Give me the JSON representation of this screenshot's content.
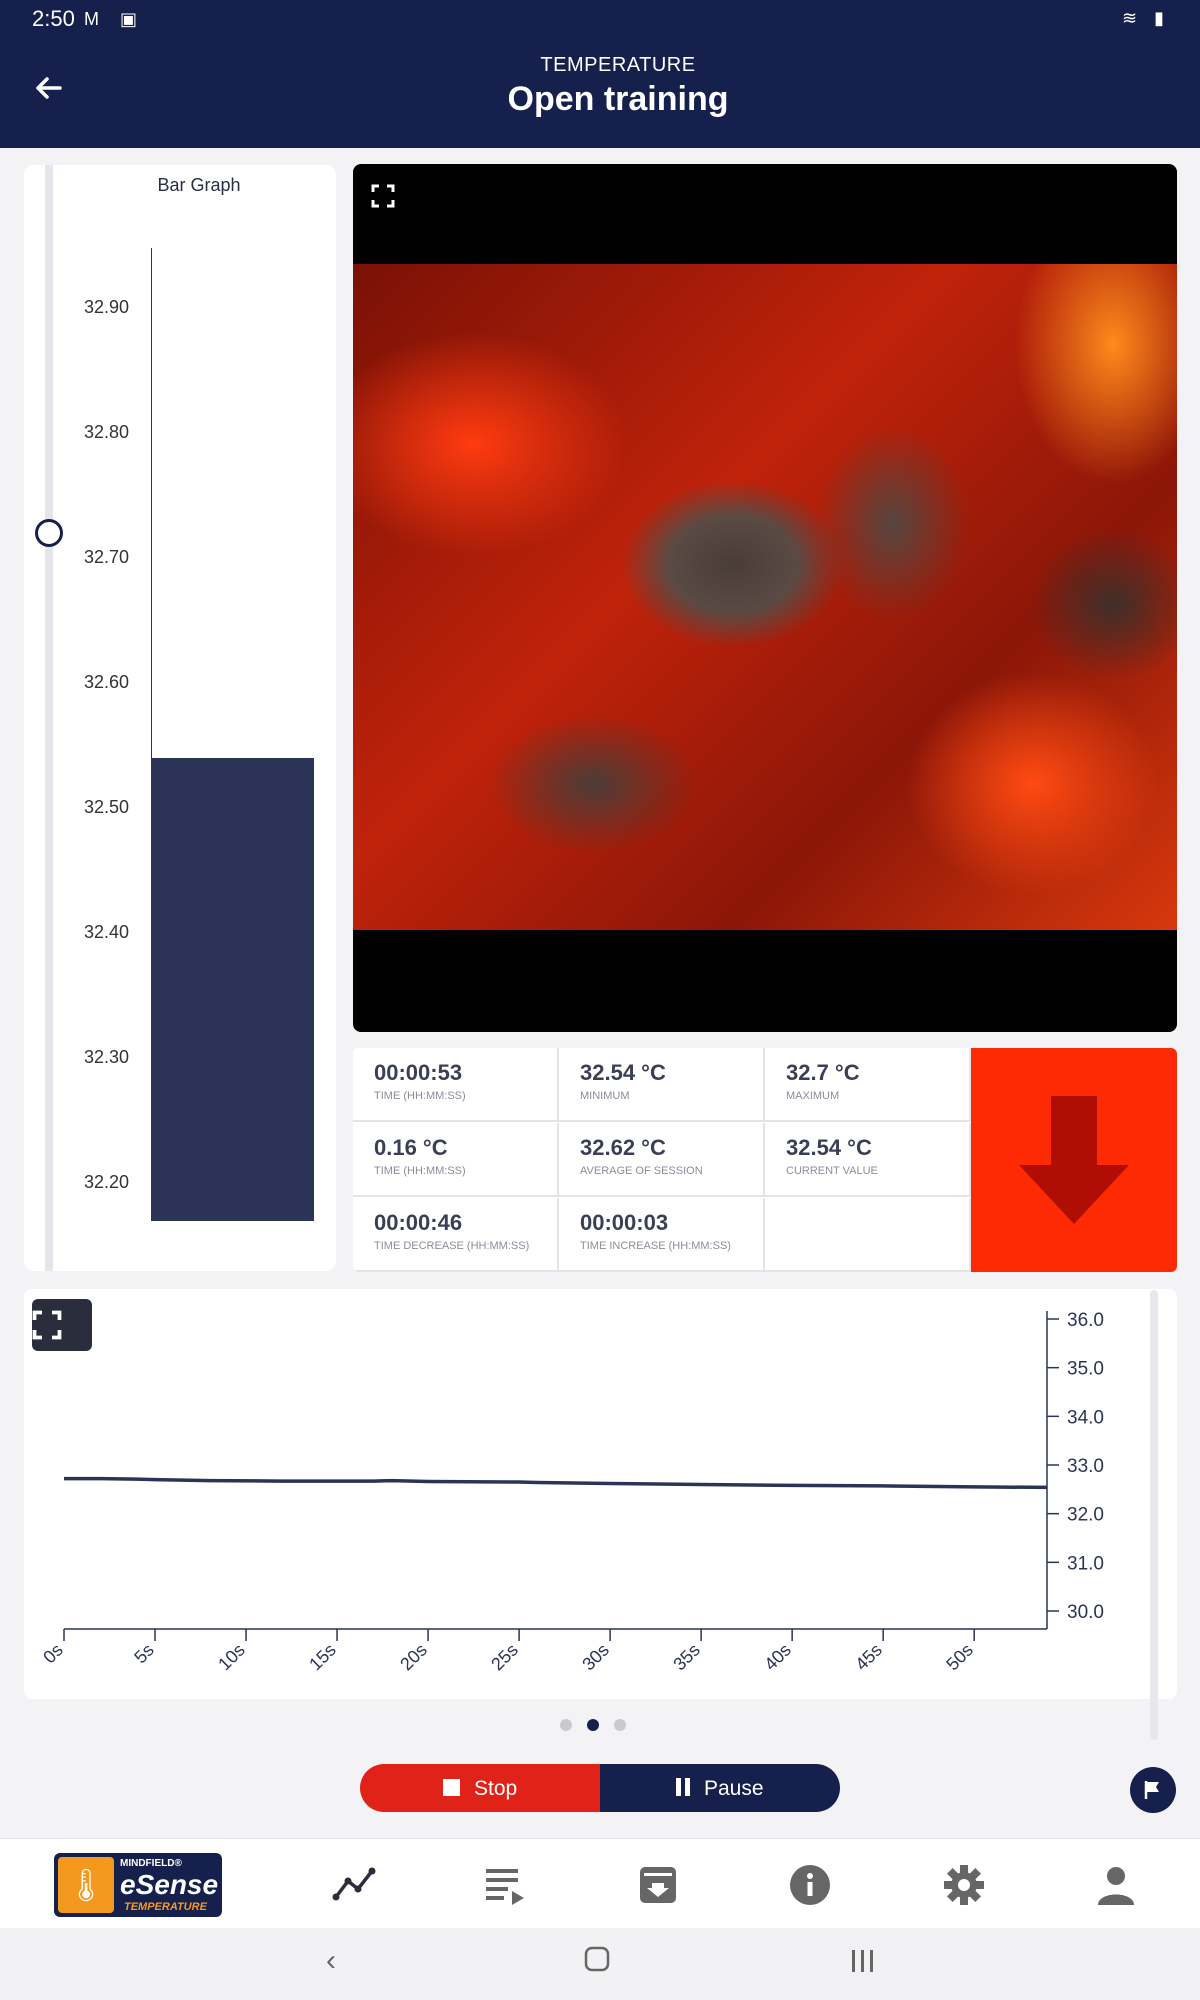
{
  "status": {
    "time": "2:50",
    "left_icons": "M ▣",
    "right_icons": "≋ ▮"
  },
  "header": {
    "subtitle": "TEMPERATURE",
    "title": "Open training"
  },
  "bar_graph": {
    "title": "Bar Graph",
    "ticks": [
      "32.90",
      "32.80",
      "32.70",
      "32.60",
      "32.50",
      "32.40",
      "32.30",
      "32.20"
    ],
    "current_value": 32.54,
    "slider_value": 32.72
  },
  "video": {
    "description": "burning charcoal"
  },
  "stats": [
    {
      "value": "00:00:53",
      "label": "TIME (HH:MM:SS)"
    },
    {
      "value": "32.54 °C",
      "label": "MINIMUM"
    },
    {
      "value": "32.7 °C",
      "label": "MAXIMUM"
    },
    {
      "value": "0.16 °C",
      "label": "TIME (HH:MM:SS)"
    },
    {
      "value": "32.62 °C",
      "label": "AVERAGE OF SESSION"
    },
    {
      "value": "32.54 °C",
      "label": "CURRENT VALUE"
    },
    {
      "value": "00:00:46",
      "label": "TIME DECREASE (HH:MM:SS)"
    },
    {
      "value": "00:00:03",
      "label": "TIME INCREASE (HH:MM:SS)"
    },
    {
      "value": "",
      "label": ""
    }
  ],
  "trend_indicator": {
    "direction": "down",
    "color": "#fe2a04"
  },
  "chart_data": {
    "type": "line",
    "x_ticks": [
      "0s",
      "5s",
      "10s",
      "15s",
      "20s",
      "25s",
      "30s",
      "35s",
      "40s",
      "45s",
      "50s"
    ],
    "y_ticks": [
      "36.0",
      "35.0",
      "34.0",
      "33.0",
      "32.0",
      "31.0",
      "30.0"
    ],
    "ylim": [
      30,
      36
    ],
    "xlim": [
      0,
      54
    ],
    "y_axis_position": "right",
    "grid": false,
    "series": [
      {
        "color": "#2b3457",
        "x": [
          0,
          2,
          4,
          5,
          8,
          12,
          17,
          18,
          20,
          25,
          26,
          30,
          35,
          40,
          45,
          50,
          54
        ],
        "y": [
          32.72,
          32.72,
          32.71,
          32.7,
          32.68,
          32.67,
          32.67,
          32.68,
          32.66,
          32.65,
          32.64,
          32.62,
          32.6,
          32.58,
          32.57,
          32.55,
          32.54
        ]
      }
    ]
  },
  "pager": {
    "count": 3,
    "active": 1
  },
  "controls": {
    "stop_label": "Stop",
    "pause_label": "Pause"
  },
  "logo": {
    "brand": "MINDFIELD®",
    "product": "eSense",
    "mode": "TEMPERATURE"
  },
  "nav_items": [
    "chart-icon",
    "playlist-icon",
    "archive-icon",
    "info-icon",
    "settings-icon",
    "profile-icon"
  ],
  "colors": {
    "primary": "#15204d",
    "stop": "#e02218",
    "bar": "#2b3457"
  }
}
